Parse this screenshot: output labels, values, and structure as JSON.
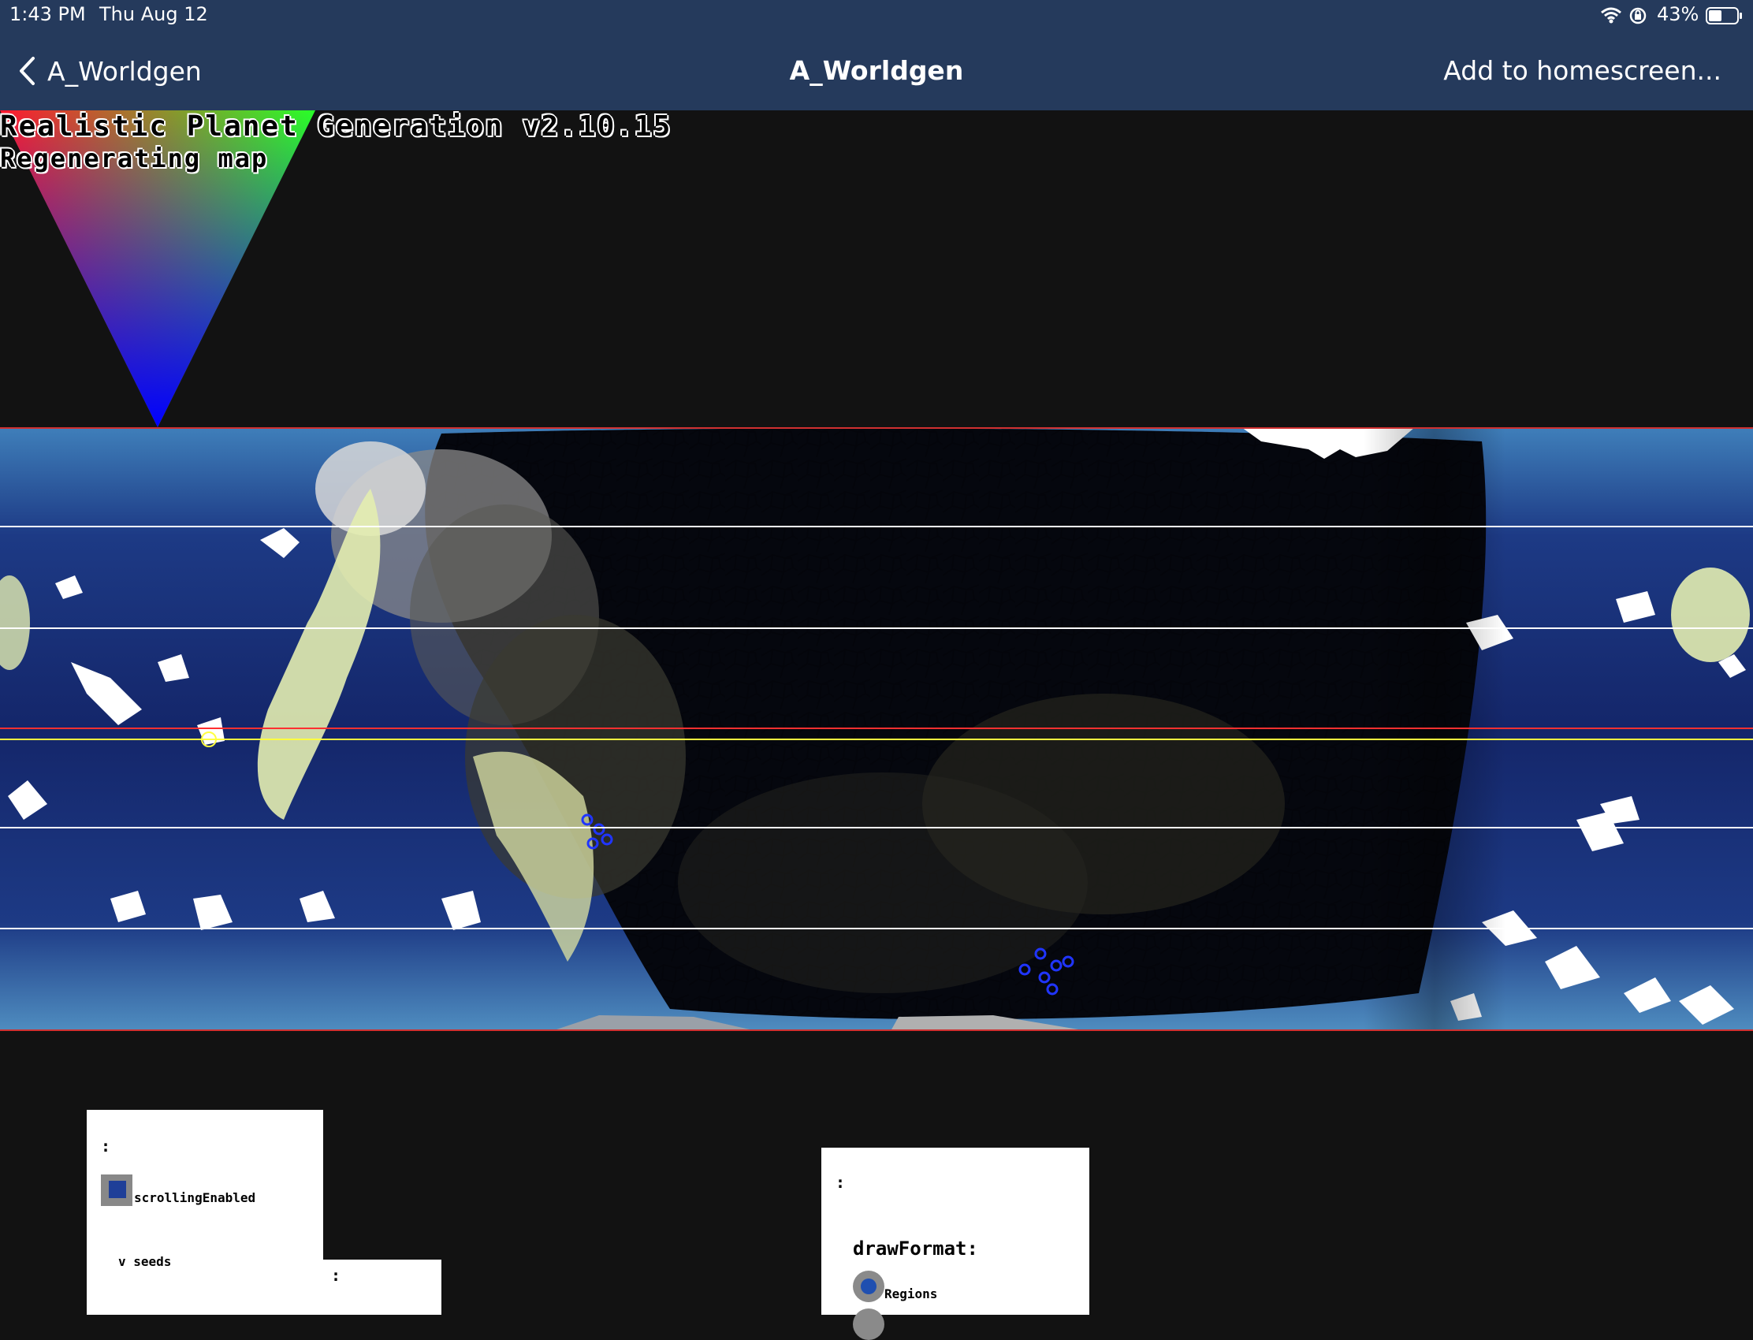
{
  "status_bar": {
    "time": "1:43 PM",
    "date": "Thu Aug 12",
    "battery": "43%"
  },
  "nav": {
    "back_label": "A_Worldgen",
    "title": "A_Worldgen",
    "action": "Add to homescreen..."
  },
  "overlay": {
    "title": "Realistic Planet Generation v2.10.15",
    "status": "Regenerating map"
  },
  "panel_left": {
    "colon_top": ":",
    "checkbox_label": "scrollingEnabled",
    "seeds_label": "v seeds",
    "colon_bottom": ":"
  },
  "panel_right": {
    "colon": ":",
    "format_label": "drawFormat:",
    "option_regions": "Regions"
  },
  "colors": {
    "bar": "#253a5c",
    "background": "#121212",
    "ocean_deep": "#12205a",
    "ocean_shallow": "#4f8dc0",
    "ice": "#ffffff",
    "land_pale": "#e3edb0"
  }
}
